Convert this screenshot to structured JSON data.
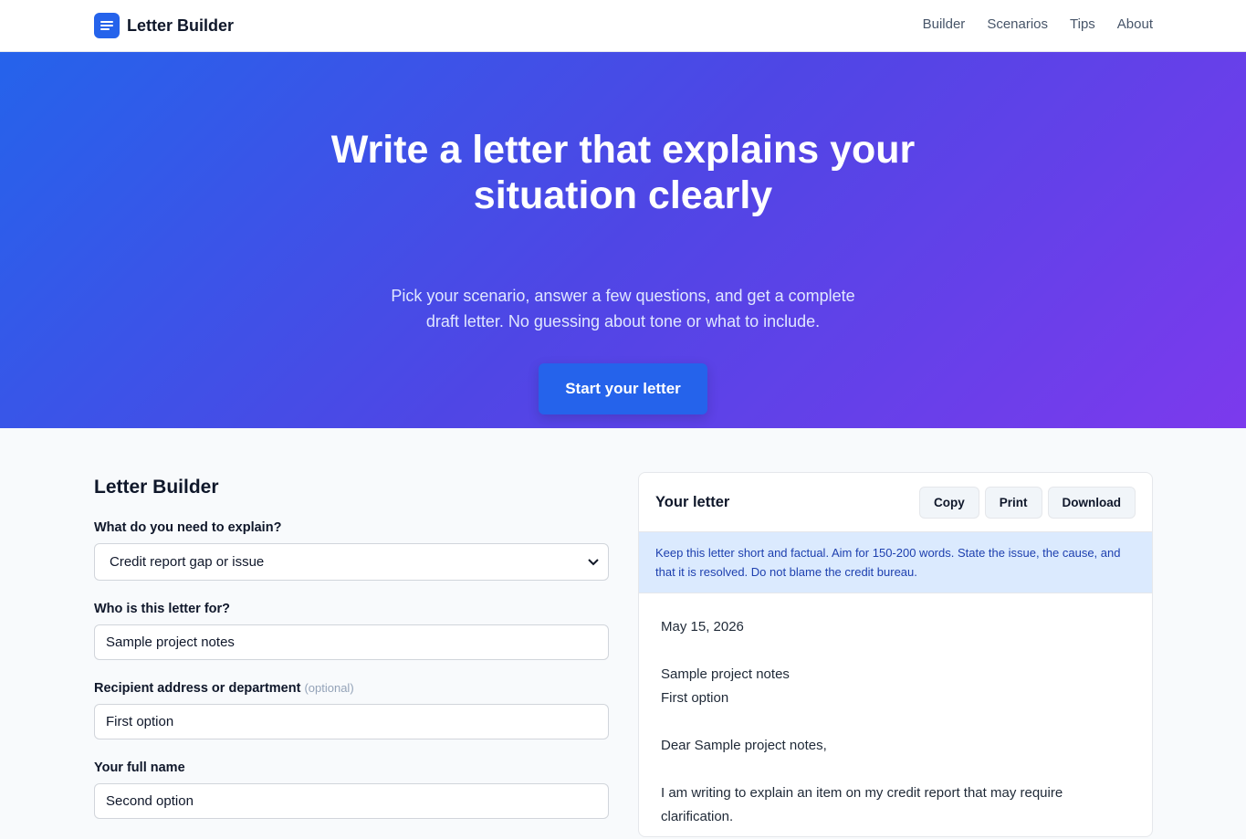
{
  "brand": {
    "name": "Letter Builder",
    "icon": "lines-icon"
  },
  "nav": [
    {
      "label": "Builder"
    },
    {
      "label": "Scenarios"
    },
    {
      "label": "Tips"
    },
    {
      "label": "About"
    }
  ],
  "hero": {
    "title": "Write a letter that explains your situation clearly",
    "subtitle": "Pick your scenario, answer a few questions, and get a complete draft letter. No guessing about tone or what to include.",
    "cta_label": "Start your letter"
  },
  "form": {
    "title": "Letter Builder",
    "scenario": {
      "label": "What do you need to explain?",
      "value": "Credit report gap or issue"
    },
    "recipient": {
      "label": "Who is this letter for?",
      "value": "Sample project notes"
    },
    "address": {
      "label": "Recipient address or department",
      "optional_label": "(optional)",
      "value": "First option"
    },
    "full_name": {
      "label": "Your full name",
      "value": "Second option"
    }
  },
  "preview": {
    "title": "Your letter",
    "copy_label": "Copy",
    "print_label": "Print",
    "download_label": "Download",
    "tip": "Keep this letter short and factual. Aim for 150-200 words. State the issue, the cause, and that it is resolved. Do not blame the credit bureau.",
    "letter": {
      "date": "May 15, 2026",
      "recipient_line1": "Sample project notes",
      "recipient_line2": "First option",
      "salutation": "Dear Sample project notes,",
      "body": "I am writing to explain an item on my credit report that may require clarification."
    }
  },
  "colors": {
    "primary": "#2563eb",
    "gradient_end": "#7c3aed",
    "tip_bg": "#dbeafe"
  }
}
